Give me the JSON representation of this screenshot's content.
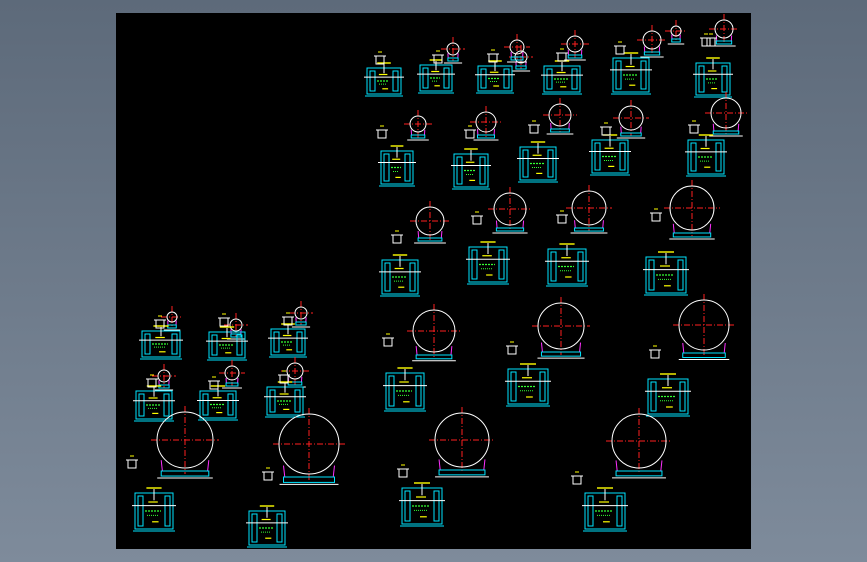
{
  "viewer": {
    "drawing_sheet": "cad-drawing-sheet",
    "tank_detail_count": 37
  },
  "colors": {
    "background": "#000000",
    "viewport": "#6f7c8c",
    "circle": "#ffffff",
    "centerline": "#ff2020",
    "frame": "#00e5ff",
    "saddle": "#ff30ff",
    "dimension": "#ffff00",
    "note_text": "#33ff33",
    "leader": "#ffffff"
  },
  "icons": {
    "tank_plan": "circle-with-crosshair",
    "tank_elevation": "cyan-bracket-frame",
    "support_detail": "u-bracket"
  }
}
